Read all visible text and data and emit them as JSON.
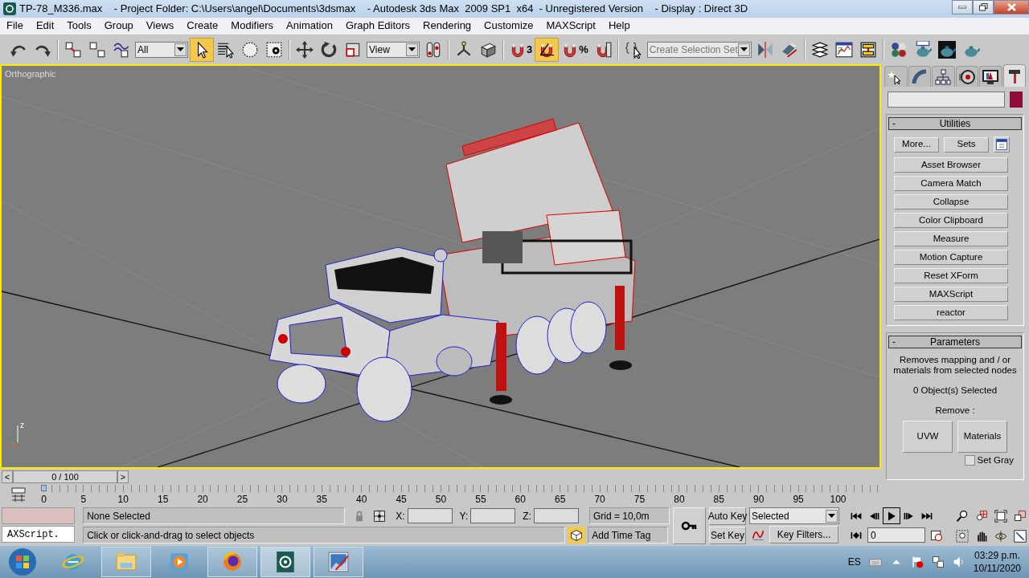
{
  "window": {
    "title": "TP-78_M336.max    - Project Folder: C:\\Users\\angel\\Documents\\3dsmax    - Autodesk 3ds Max  2009 SP1  x64  - Unregistered Version    - Display : Direct 3D"
  },
  "menu": [
    "File",
    "Edit",
    "Tools",
    "Group",
    "Views",
    "Create",
    "Modifiers",
    "Animation",
    "Graph Editors",
    "Rendering",
    "Customize",
    "MAXScript",
    "Help"
  ],
  "toolbar": [
    {
      "kind": "undo",
      "selected": false
    },
    {
      "kind": "redo",
      "selected": false
    },
    {
      "kind": "separator"
    },
    {
      "kind": "link",
      "selected": false
    },
    {
      "kind": "unlink",
      "selected": false
    },
    {
      "kind": "bind",
      "selected": false
    },
    {
      "kind": "dropdown",
      "value": "All"
    },
    {
      "kind": "select",
      "selected": true
    },
    {
      "kind": "select-name",
      "selected": false
    },
    {
      "kind": "region",
      "selected": false
    },
    {
      "kind": "window",
      "selected": false
    },
    {
      "kind": "separator"
    },
    {
      "kind": "move",
      "selected": false
    },
    {
      "kind": "rotate",
      "selected": false
    },
    {
      "kind": "scale",
      "selected": false
    },
    {
      "kind": "dropdown",
      "value": "View"
    },
    {
      "kind": "pivot",
      "selected": false
    },
    {
      "kind": "separator"
    },
    {
      "kind": "manipulate",
      "selected": false
    },
    {
      "kind": "keyboard",
      "selected": false
    },
    {
      "kind": "separator"
    },
    {
      "kind": "snap",
      "badge": "3",
      "selected": false
    },
    {
      "kind": "angle",
      "selected": true
    },
    {
      "kind": "percent",
      "badge": "%",
      "selected": false
    },
    {
      "kind": "spinner",
      "selected": false
    },
    {
      "kind": "separator"
    },
    {
      "kind": "edit-set",
      "selected": false
    },
    {
      "kind": "dropdown",
      "placeholder": "Create Selection Set"
    },
    {
      "kind": "mirror",
      "selected": false
    },
    {
      "kind": "align",
      "selected": false
    },
    {
      "kind": "separator"
    },
    {
      "kind": "layers",
      "selected": false
    },
    {
      "kind": "curve",
      "selected": false
    },
    {
      "kind": "schematic",
      "selected": false
    },
    {
      "kind": "separator"
    },
    {
      "kind": "material",
      "selected": false
    },
    {
      "kind": "render-setup",
      "selected": false
    },
    {
      "kind": "render-frame",
      "selected": false
    },
    {
      "kind": "quick-render",
      "selected": false
    }
  ],
  "viewport": {
    "label": "Orthographic",
    "axis_label": "z"
  },
  "time_slider": {
    "prev": "<",
    "position": "0 / 100",
    "next": ">",
    "level": 0
  },
  "timeline": {
    "ticks": [
      "0",
      "5",
      "10",
      "15",
      "20",
      "25",
      "30",
      "35",
      "40",
      "45",
      "50",
      "55",
      "60",
      "65",
      "70",
      "75",
      "80",
      "85",
      "90",
      "95",
      "100"
    ]
  },
  "command_panel": {
    "tabs": [
      {
        "kind": "create",
        "selected": false
      },
      {
        "kind": "modify",
        "selected": false
      },
      {
        "kind": "hierarchy",
        "selected": false
      },
      {
        "kind": "motion",
        "selected": false
      },
      {
        "kind": "display",
        "selected": false
      },
      {
        "kind": "utilities",
        "selected": true
      }
    ]
  },
  "utilities": {
    "collapse": "-",
    "title": "Utilities",
    "buttons": [
      "More...",
      "Sets"
    ],
    "list": [
      "Asset Browser",
      "Camera Match",
      "Collapse",
      "Color Clipboard",
      "Measure",
      "Motion Capture",
      "Reset XForm",
      "MAXScript",
      "reactor"
    ]
  },
  "parameters": {
    "collapse": "-",
    "title": "Parameters",
    "description": "Removes mapping and / or materials from selected nodes",
    "count": "0 Object(s) Selected",
    "remove_label": "Remove :",
    "buttons": [
      "UVW",
      "Materials"
    ],
    "set_gray": {
      "label": "Set Gray",
      "checked": false
    }
  },
  "status": {
    "listener": "AXScript.",
    "selection": "None Selected",
    "coords": [
      "X:",
      "Y:",
      "Z:"
    ],
    "grid": "Grid = 10,0m",
    "prompt": "Click or click-and-drag to select objects",
    "time_tag": "Add Time Tag",
    "auto_key": "Auto Key",
    "set_key": "Set Key",
    "key_mode": "Selected",
    "key_filters": "Key Filters...",
    "frame": "0"
  },
  "taskbar": {
    "apps": [
      {
        "kind": "browser",
        "running": false,
        "selected": false
      },
      {
        "kind": "folder",
        "running": true,
        "selected": false
      },
      {
        "kind": "media",
        "running": false,
        "selected": false
      },
      {
        "kind": "firefox",
        "running": true,
        "selected": false
      },
      {
        "kind": "max",
        "running": true,
        "selected": true
      },
      {
        "kind": "paint",
        "running": true,
        "selected": false
      }
    ],
    "language": "ES",
    "time": "03:29 p.m.",
    "date": "10/11/2020"
  }
}
